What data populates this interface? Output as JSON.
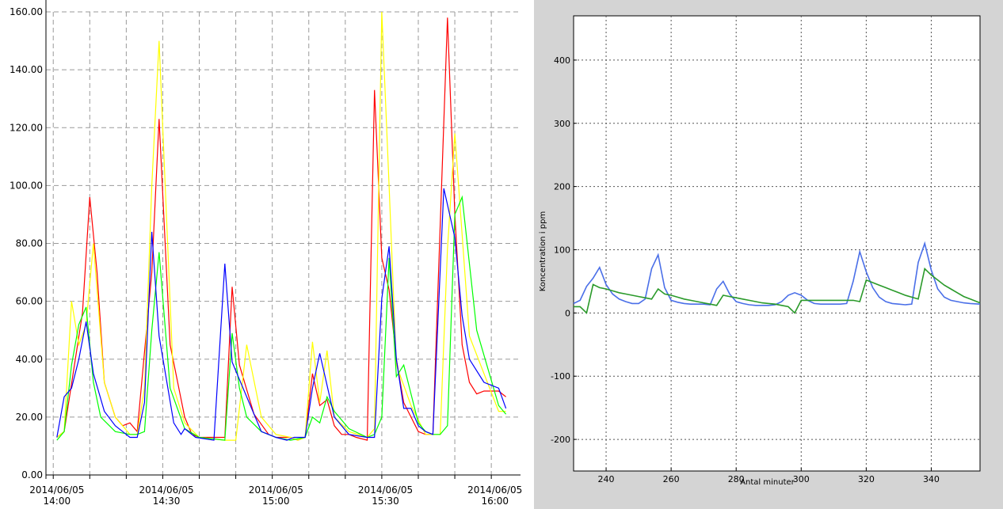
{
  "chart_data": [
    {
      "type": "line",
      "title": "",
      "xlabel": "",
      "ylabel": "",
      "ylim": [
        0,
        160
      ],
      "yticks": [
        "0.00",
        "20.00",
        "40.00",
        "60.00",
        "80.00",
        "100.00",
        "120.00",
        "140.00",
        "160.00"
      ],
      "xticks": [
        {
          "date": "2014/06/05",
          "time": "14:00",
          "x": 0
        },
        {
          "date": "2014/06/05",
          "time": "14:30",
          "x": 30
        },
        {
          "date": "2014/06/05",
          "time": "15:00",
          "x": 60
        },
        {
          "date": "2014/06/05",
          "time": "15:30",
          "x": 90
        },
        {
          "date": "2014/06/05",
          "time": "16:00",
          "x": 120
        }
      ],
      "xlim": [
        -3,
        127
      ],
      "grid": true,
      "series": [
        {
          "color": "#ff0000",
          "x": [
            0,
            2,
            7,
            9,
            11,
            13,
            16,
            18,
            20,
            22,
            26,
            28,
            31,
            35,
            37,
            39,
            44,
            46,
            48,
            50,
            54,
            58,
            60,
            64,
            66,
            68,
            70,
            72,
            74,
            76,
            78,
            80,
            82,
            85,
            87,
            89,
            91,
            93,
            95,
            99,
            101,
            103,
            107,
            109,
            111,
            113,
            115,
            117,
            121,
            123
          ],
          "y": [
            13,
            15,
            56,
            96,
            70,
            32,
            20,
            17,
            18,
            15,
            70,
            123,
            45,
            20,
            14,
            13,
            13,
            13,
            65,
            38,
            21,
            14,
            13,
            13,
            12,
            13,
            35,
            24,
            26,
            17,
            14,
            14,
            13,
            12,
            133,
            75,
            64,
            40,
            25,
            15,
            14,
            14,
            158,
            90,
            45,
            32,
            28,
            29,
            29,
            27
          ],
          "note": ""
        },
        {
          "color": "#ffff00",
          "x": [
            0,
            2,
            4,
            6,
            8,
            10,
            13,
            16,
            20,
            22,
            24,
            26,
            28,
            32,
            35,
            39,
            46,
            49,
            52,
            56,
            60,
            64,
            66,
            68,
            70,
            72,
            74,
            76,
            80,
            85,
            87,
            89,
            91,
            93,
            97,
            101,
            105,
            107,
            109,
            113,
            117,
            121,
            123
          ],
          "y": [
            13,
            15,
            60,
            45,
            52,
            80,
            32,
            20,
            14,
            14,
            30,
            100,
            150,
            30,
            18,
            13,
            12,
            12,
            45,
            20,
            14,
            13,
            12,
            13,
            46,
            25,
            43,
            20,
            15,
            13,
            16,
            160,
            100,
            38,
            24,
            14,
            14,
            78,
            118,
            48,
            35,
            22,
            22
          ],
          "note": ""
        },
        {
          "color": "#00ff00",
          "x": [
            0,
            2,
            4,
            6,
            8,
            10,
            12,
            16,
            20,
            22,
            24,
            26,
            28,
            31,
            35,
            39,
            46,
            48,
            50,
            52,
            56,
            60,
            64,
            68,
            70,
            72,
            74,
            76,
            80,
            85,
            87,
            89,
            91,
            93,
            95,
            99,
            101,
            103,
            105,
            107,
            109,
            111,
            115,
            121,
            123
          ],
          "y": [
            12,
            15,
            38,
            52,
            58,
            32,
            20,
            15,
            14,
            14,
            15,
            50,
            77,
            30,
            16,
            13,
            12,
            49,
            30,
            20,
            15,
            13,
            12,
            13,
            20,
            18,
            27,
            22,
            16,
            13,
            14,
            20,
            75,
            34,
            38,
            18,
            15,
            14,
            14,
            17,
            90,
            96,
            50,
            24,
            21
          ],
          "note": ""
        },
        {
          "color": "#0000ff",
          "x": [
            0,
            2,
            4,
            6,
            8,
            10,
            13,
            16,
            18,
            20,
            22,
            24,
            26,
            28,
            32,
            34,
            35,
            38,
            43,
            46,
            48,
            52,
            56,
            60,
            63,
            65,
            68,
            70,
            72,
            76,
            80,
            85,
            87,
            89,
            91,
            93,
            95,
            97,
            99,
            101,
            103,
            106,
            109,
            111,
            113,
            117,
            121,
            123
          ],
          "y": [
            13,
            27,
            30,
            40,
            53,
            35,
            22,
            17,
            15,
            13,
            13,
            25,
            84,
            48,
            18,
            14,
            16,
            13,
            12,
            73,
            39,
            27,
            15,
            13,
            12,
            13,
            13,
            30,
            42,
            20,
            14,
            13,
            13,
            61,
            79,
            40,
            23,
            23,
            17,
            15,
            14,
            99,
            82,
            55,
            40,
            32,
            30,
            23
          ],
          "note": ""
        }
      ]
    },
    {
      "type": "line",
      "title": "",
      "xlabel": "Antal minuter",
      "ylabel": "Koncentration i ppm",
      "xlim": [
        230,
        355
      ],
      "ylim": [
        -250,
        470
      ],
      "xticks": [
        240,
        260,
        280,
        300,
        320,
        340
      ],
      "yticks": [
        -200,
        -100,
        0,
        100,
        200,
        300,
        400
      ],
      "grid": true,
      "series": [
        {
          "color": "#4a6fe8",
          "x": [
            230,
            232,
            234,
            236,
            238,
            240,
            242,
            244,
            246,
            248,
            250,
            252,
            254,
            256,
            258,
            260,
            262,
            264,
            266,
            268,
            270,
            272,
            274,
            276,
            278,
            280,
            282,
            284,
            286,
            288,
            290,
            292,
            294,
            296,
            298,
            300,
            302,
            304,
            306,
            308,
            310,
            312,
            314,
            316,
            318,
            320,
            322,
            324,
            326,
            328,
            330,
            332,
            334,
            336,
            338,
            340,
            342,
            344,
            346,
            348,
            350,
            352,
            355
          ],
          "y": [
            15,
            20,
            42,
            55,
            72,
            45,
            30,
            22,
            18,
            15,
            15,
            22,
            70,
            92,
            40,
            20,
            17,
            15,
            14,
            14,
            14,
            13,
            38,
            50,
            30,
            18,
            15,
            13,
            12,
            12,
            12,
            13,
            18,
            28,
            32,
            28,
            20,
            15,
            14,
            14,
            14,
            14,
            15,
            50,
            97,
            65,
            40,
            25,
            18,
            15,
            14,
            13,
            14,
            80,
            110,
            68,
            38,
            25,
            20,
            18,
            16,
            15,
            14
          ]
        },
        {
          "color": "#2a9a2a",
          "x": [
            230,
            232,
            234,
            236,
            238,
            240,
            242,
            244,
            246,
            248,
            250,
            252,
            254,
            256,
            258,
            260,
            262,
            264,
            266,
            268,
            270,
            272,
            274,
            276,
            278,
            280,
            282,
            284,
            286,
            288,
            290,
            292,
            294,
            296,
            298,
            300,
            302,
            304,
            306,
            308,
            310,
            312,
            314,
            316,
            318,
            320,
            322,
            324,
            326,
            328,
            330,
            332,
            334,
            336,
            338,
            340,
            342,
            344,
            346,
            348,
            350,
            352,
            355
          ],
          "y": [
            10,
            10,
            0,
            45,
            40,
            38,
            35,
            32,
            30,
            28,
            26,
            24,
            22,
            38,
            30,
            28,
            25,
            22,
            20,
            18,
            16,
            14,
            12,
            28,
            26,
            24,
            22,
            20,
            18,
            16,
            15,
            14,
            12,
            10,
            0,
            20,
            20,
            20,
            20,
            20,
            20,
            20,
            20,
            20,
            18,
            52,
            48,
            44,
            40,
            36,
            32,
            28,
            25,
            22,
            70,
            60,
            52,
            44,
            38,
            32,
            26,
            22,
            16
          ]
        }
      ]
    }
  ]
}
